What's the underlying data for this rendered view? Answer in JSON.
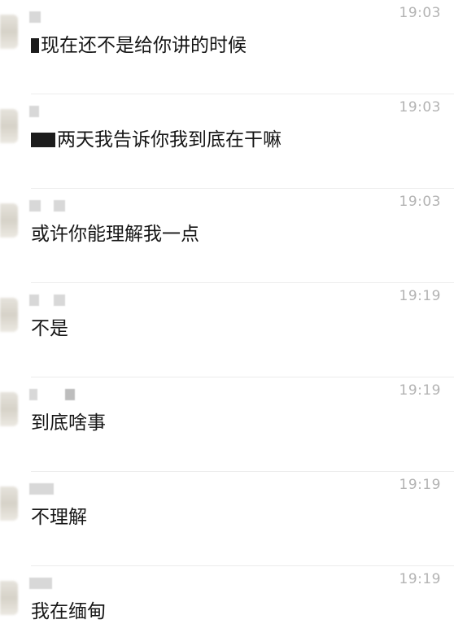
{
  "chat": {
    "messages": [
      {
        "time": "19:03",
        "text": "现在还不是给你讲的时候"
      },
      {
        "time": "19:03",
        "text": "两天我告诉你我到底在干嘛"
      },
      {
        "time": "19:03",
        "text": "或许你能理解我一点"
      },
      {
        "time": "19:19",
        "text": "不是"
      },
      {
        "time": "19:19",
        "text": "到底啥事"
      },
      {
        "time": "19:19",
        "text": "不理解"
      },
      {
        "time": "19:19",
        "text": "我在缅甸"
      }
    ]
  }
}
